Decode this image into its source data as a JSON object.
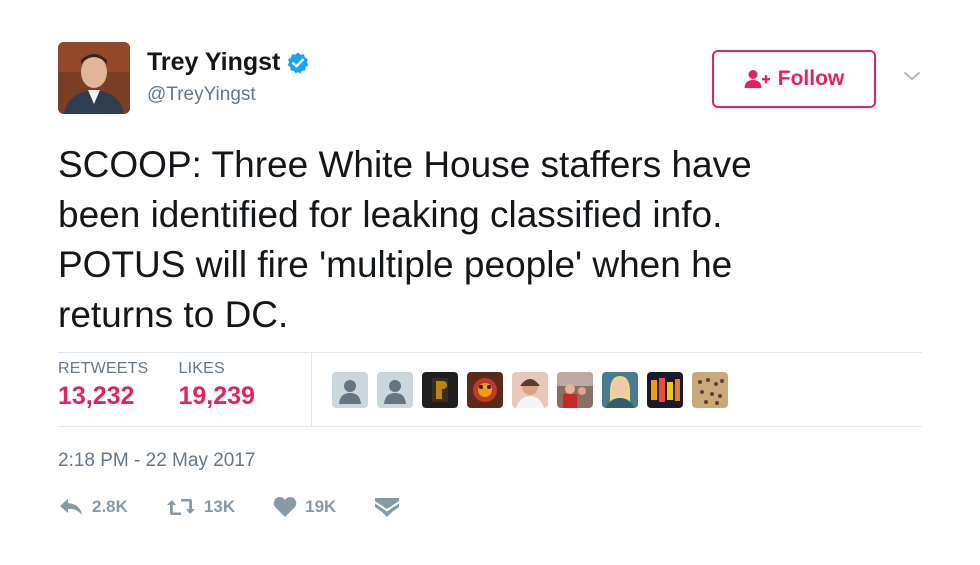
{
  "author": {
    "name": "Trey Yingst",
    "handle": "@TreyYingst"
  },
  "follow_button": {
    "label": "Follow"
  },
  "tweet": {
    "lines": [
      "SCOOP: Three White House staffers have",
      "been identified for leaking classified info.",
      "POTUS will fire 'multiple people' when he",
      "returns to DC."
    ]
  },
  "stats": {
    "retweets_label": "RETWEETS",
    "retweets_value": "13,232",
    "likes_label": "LIKES",
    "likes_value": "19,239"
  },
  "timestamp": "2:18 PM - 22 May 2017",
  "actions": {
    "reply_count": "2.8K",
    "retweet_count": "13K",
    "like_count": "19K"
  },
  "colors": {
    "accent": "#e0245e",
    "verified": "#1da1f2",
    "muted": "#657786",
    "icon": "#8899a6"
  },
  "icons": {
    "verified": "verified-badge-icon",
    "follow": "add-user-icon",
    "more": "chevron-down-icon",
    "reply": "reply-icon",
    "retweet": "retweet-icon",
    "like": "heart-icon",
    "message": "direct-message-icon"
  }
}
